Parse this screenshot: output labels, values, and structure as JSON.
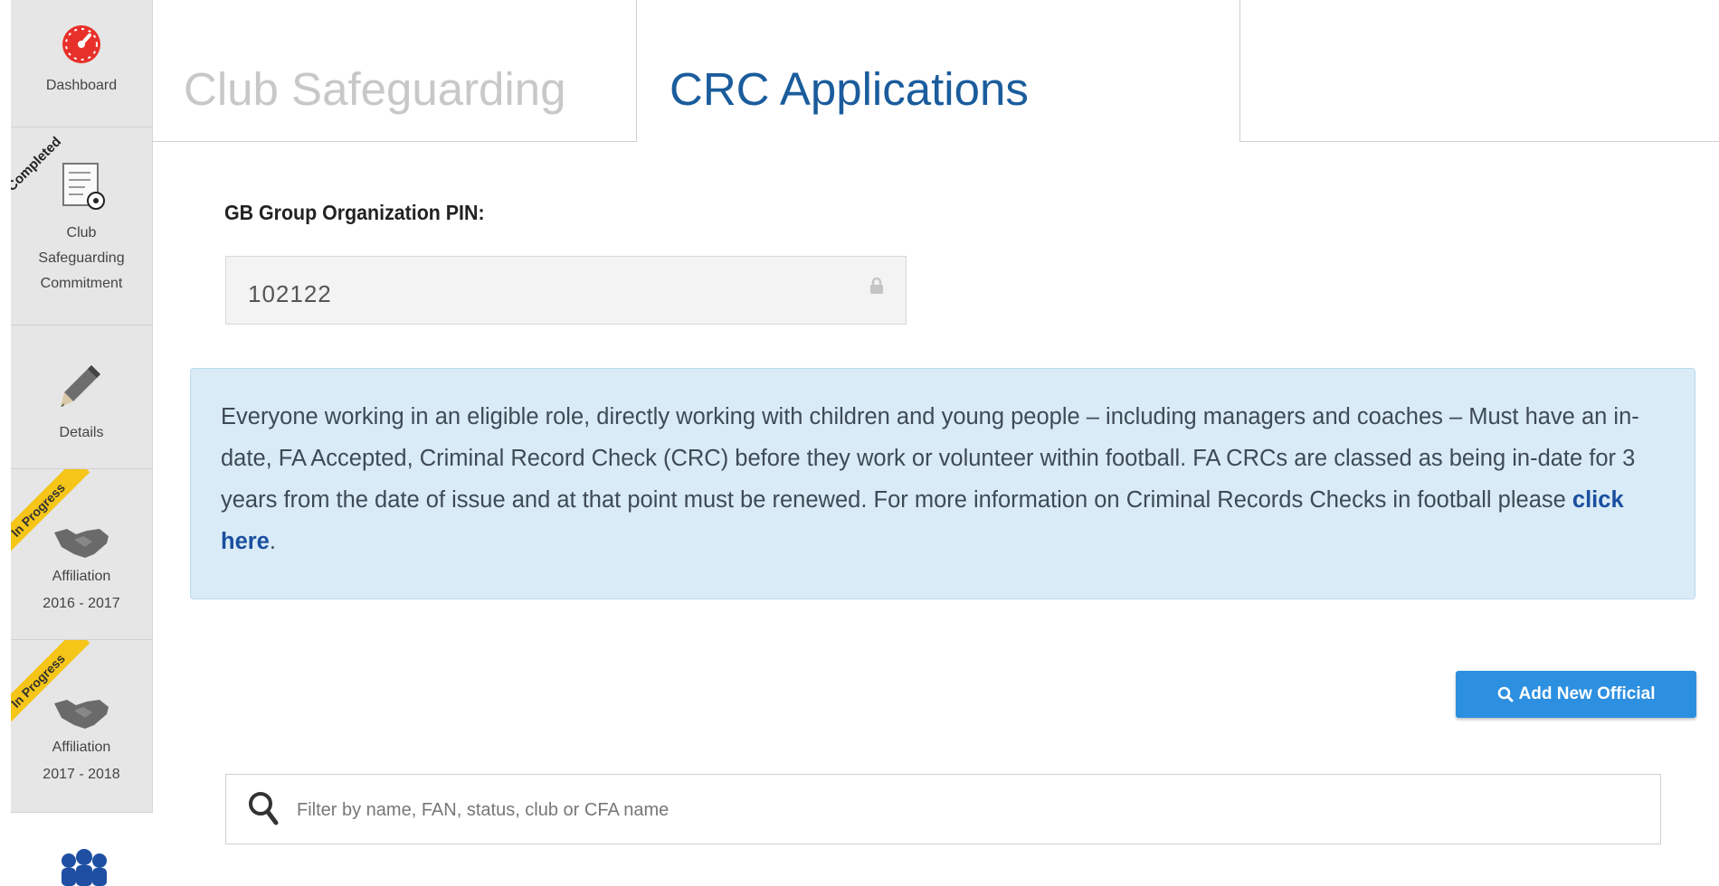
{
  "sidebar": {
    "items": [
      {
        "label": "Dashboard",
        "icon": "speedometer-icon"
      },
      {
        "label_lines": [
          "Club",
          "Safeguarding",
          "Commitment"
        ],
        "ribbon": "Completed",
        "icon": "document-football-icon"
      },
      {
        "label": "Details",
        "icon": "pencil-icon"
      },
      {
        "label_lines": [
          "Affiliation",
          "2016 - 2017"
        ],
        "ribbon": "In Progress",
        "icon": "handshake-icon"
      },
      {
        "label_lines": [
          "Affiliation",
          "2017 - 2018"
        ],
        "ribbon": "In Progress",
        "icon": "handshake-icon"
      }
    ]
  },
  "tabs": [
    {
      "label": "Club Safeguarding",
      "active": false
    },
    {
      "label": "CRC Applications",
      "active": true
    }
  ],
  "pin": {
    "label": "GB Group Organization PIN:",
    "value": "102122"
  },
  "info": {
    "text": "Everyone working in an eligible role, directly working with children and young people – including managers and coaches – Must have an in-date, FA Accepted, Criminal Record Check (CRC) before they work or volunteer within football. FA CRCs are classed as being in-date for 3 years from the date of issue and at that point must be renewed. For more information on Criminal Records Checks in football please ",
    "link": "click here",
    "end": "."
  },
  "actions": {
    "add_official": "Add New Official"
  },
  "filter": {
    "placeholder": "Filter by name, FAN, status, club or CFA name"
  },
  "colors": {
    "accent": "#1a5c9c",
    "button": "#2d8fe0",
    "info_bg": "#d9ebf6",
    "ribbon": "#f5c518"
  }
}
